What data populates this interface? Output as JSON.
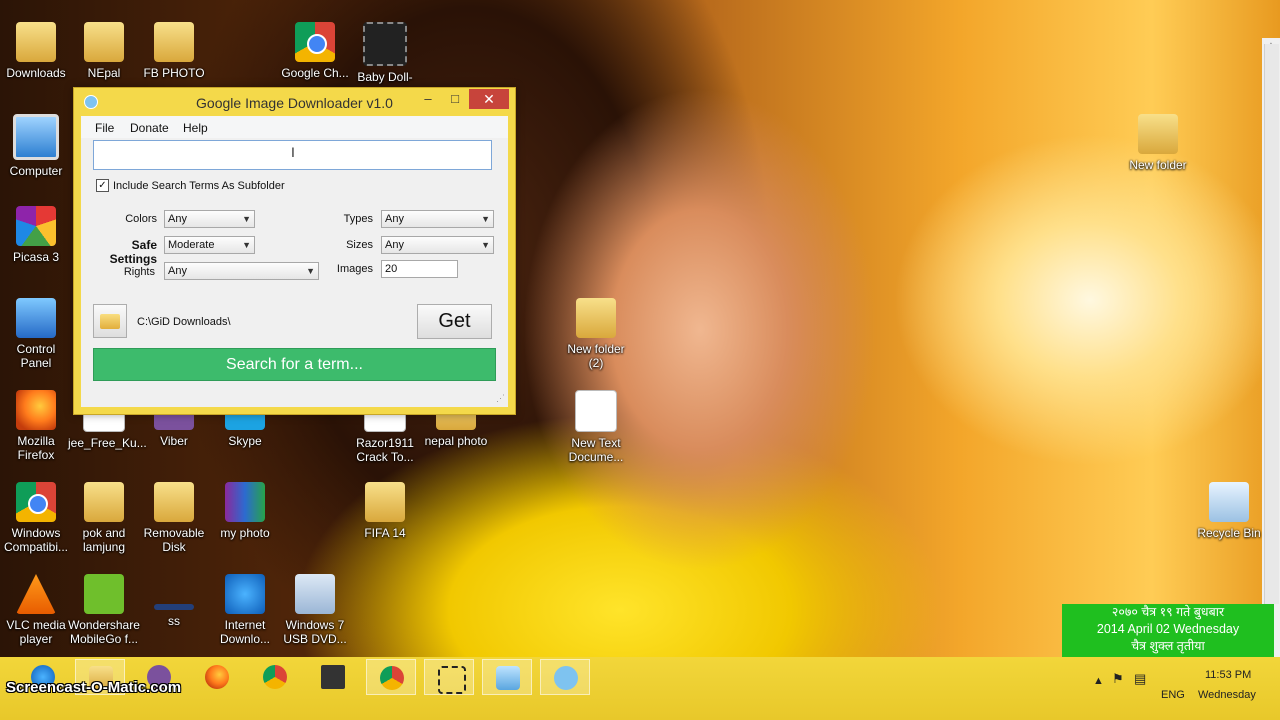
{
  "app": {
    "title": "Google Image Downloader v1.0",
    "window_buttons": {
      "minimize": "–",
      "maximize": "□",
      "close": "✕"
    },
    "menu": [
      "File",
      "Donate",
      "Help"
    ],
    "search": {
      "value": "",
      "placeholder": ""
    },
    "include_subfolder": {
      "checked": true,
      "label": "Include Search Terms As Subfolder"
    },
    "fields": {
      "colors": {
        "label": "Colors",
        "value": "Any"
      },
      "safe": {
        "label": "Safe Settings",
        "value": "Moderate"
      },
      "rights": {
        "label": "Rights",
        "value": "Any"
      },
      "types": {
        "label": "Types",
        "value": "Any"
      },
      "sizes": {
        "label": "Sizes",
        "value": "Any"
      },
      "images": {
        "label": "Images",
        "value": "20"
      }
    },
    "path": "C:\\GiD Downloads\\",
    "get_label": "Get",
    "status_label": "Search for a term..."
  },
  "desktop": {
    "icons": [
      {
        "id": "downloads",
        "label": "Downloads",
        "icon": "folder-icon"
      },
      {
        "id": "nepal",
        "label": "NEpal",
        "icon": "folder-icon"
      },
      {
        "id": "fbphoto",
        "label": "FB PHOTO",
        "icon": "folder-icon"
      },
      {
        "id": "google",
        "label": "Google Ch...",
        "icon": "chrome-icon"
      },
      {
        "id": "babydoll",
        "label": "Baby Doll-",
        "icon": "video-icon"
      },
      {
        "id": "computer",
        "label": "Computer",
        "icon": "computer-icon"
      },
      {
        "id": "picasa",
        "label": "Picasa 3",
        "icon": "picasa-icon"
      },
      {
        "id": "control",
        "label": "Control Panel",
        "icon": "control-panel-icon"
      },
      {
        "id": "firefox",
        "label": "Mozilla Firefox",
        "icon": "firefox-icon"
      },
      {
        "id": "jeefree",
        "label": "jee_Free_Ku...",
        "icon": "file-icon"
      },
      {
        "id": "viber",
        "label": "Viber",
        "icon": "viber-icon"
      },
      {
        "id": "skype",
        "label": "Skype",
        "icon": "skype-icon"
      },
      {
        "id": "razor",
        "label": "Razor1911 Crack To...",
        "icon": "file-icon"
      },
      {
        "id": "nepalphoto",
        "label": "nepal photo",
        "icon": "folder-icon"
      },
      {
        "id": "chromecompat",
        "label": "Windows Compatibi...",
        "icon": "chrome-icon"
      },
      {
        "id": "pok",
        "label": "pok and lamjung",
        "icon": "folder-icon"
      },
      {
        "id": "removable",
        "label": "Removable Disk",
        "icon": "folder-icon"
      },
      {
        "id": "myphoto",
        "label": "my photo",
        "icon": "winrar-icon"
      },
      {
        "id": "fifa",
        "label": "FIFA 14",
        "icon": "folder-icon"
      },
      {
        "id": "vlc",
        "label": "VLC media player",
        "icon": "vlc-icon"
      },
      {
        "id": "mobilego",
        "label": "Wondershare MobileGo f...",
        "icon": "mobilego-icon"
      },
      {
        "id": "ss",
        "label": "ss",
        "icon": "shortcut-icon"
      },
      {
        "id": "idm",
        "label": "Internet Downlo...",
        "icon": "ie-icon"
      },
      {
        "id": "win7",
        "label": "Windows 7 USB DVD...",
        "icon": "windows-icon"
      },
      {
        "id": "newfolder",
        "label": "New folder",
        "icon": "folder-icon"
      },
      {
        "id": "newfolder2",
        "label": "New folder (2)",
        "icon": "folder-icon"
      },
      {
        "id": "newtext",
        "label": "New Text Docume...",
        "icon": "text-file-icon"
      },
      {
        "id": "recycle",
        "label": "Recycle Bin",
        "icon": "recycle-bin-icon"
      }
    ]
  },
  "calendar": {
    "line1": "२०७० चैत्र १९ गते बुधबार",
    "line2": "2014 April 02  Wednesday",
    "line3": "चैत्र  शुक्ल तृतीया"
  },
  "taskbar": {
    "watermark": "Screencast-O-Matic.com",
    "lang": "ENG",
    "time": "11:53 PM",
    "day": "Wednesday",
    "items": [
      "ie-icon",
      "explorer-icon",
      "viber-icon",
      "firefox-icon",
      "chrome-icon",
      "som-icon",
      "chrome-app-icon",
      "snip-icon",
      "notepad-icon",
      "gid-icon"
    ]
  },
  "colors": {
    "accent_green": "#3dbb6c",
    "window_frame": "#f4d94a",
    "close_red": "#c7443b"
  }
}
